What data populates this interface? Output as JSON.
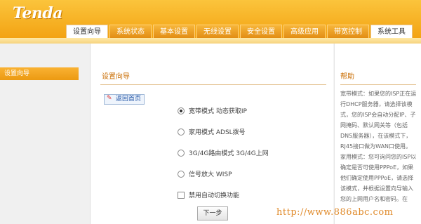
{
  "header": {
    "logo": "Tenda",
    "tabs": [
      "设置向导",
      "系统状态",
      "基本设置",
      "无线设置",
      "安全设置",
      "高级应用",
      "带宽控制",
      "系统工具"
    ]
  },
  "sidebar": {
    "items": [
      {
        "label": "设置向导"
      }
    ]
  },
  "main": {
    "title": "设置向导",
    "home_link": "返回首页",
    "options": [
      {
        "label": "宽带模式 动态获取IP",
        "type": "radio",
        "selected": true
      },
      {
        "label": "家用模式 ADSL拨号",
        "type": "radio",
        "selected": false
      },
      {
        "label": "3G/4G路由模式 3G/4G上网",
        "type": "radio",
        "selected": false
      },
      {
        "label": "信号放大 WISP",
        "type": "radio",
        "selected": false
      },
      {
        "label": "禁用自动切换功能",
        "type": "checkbox",
        "selected": false
      }
    ],
    "next_button": "下一步"
  },
  "help": {
    "title": "帮助",
    "text": "宽带模式：如果您的ISP正在运行DHCP服务器，请选择该模式，您的ISP会自动分配IP、子网掩码、默认网关等（包括DNS服务器），在该模式下，RJ45接口做为WAN口使用。 家用模式：您可询问您的ISP以确定是否可使用PPPoE，如果他们确定使用PPPoE，请选择该模式，并根据设置向导输入您的上网用户名和密码。在"
  },
  "watermark": "http://www.886abc.com",
  "colors": {
    "accent": "#f3a313",
    "title": "#c96c00"
  }
}
